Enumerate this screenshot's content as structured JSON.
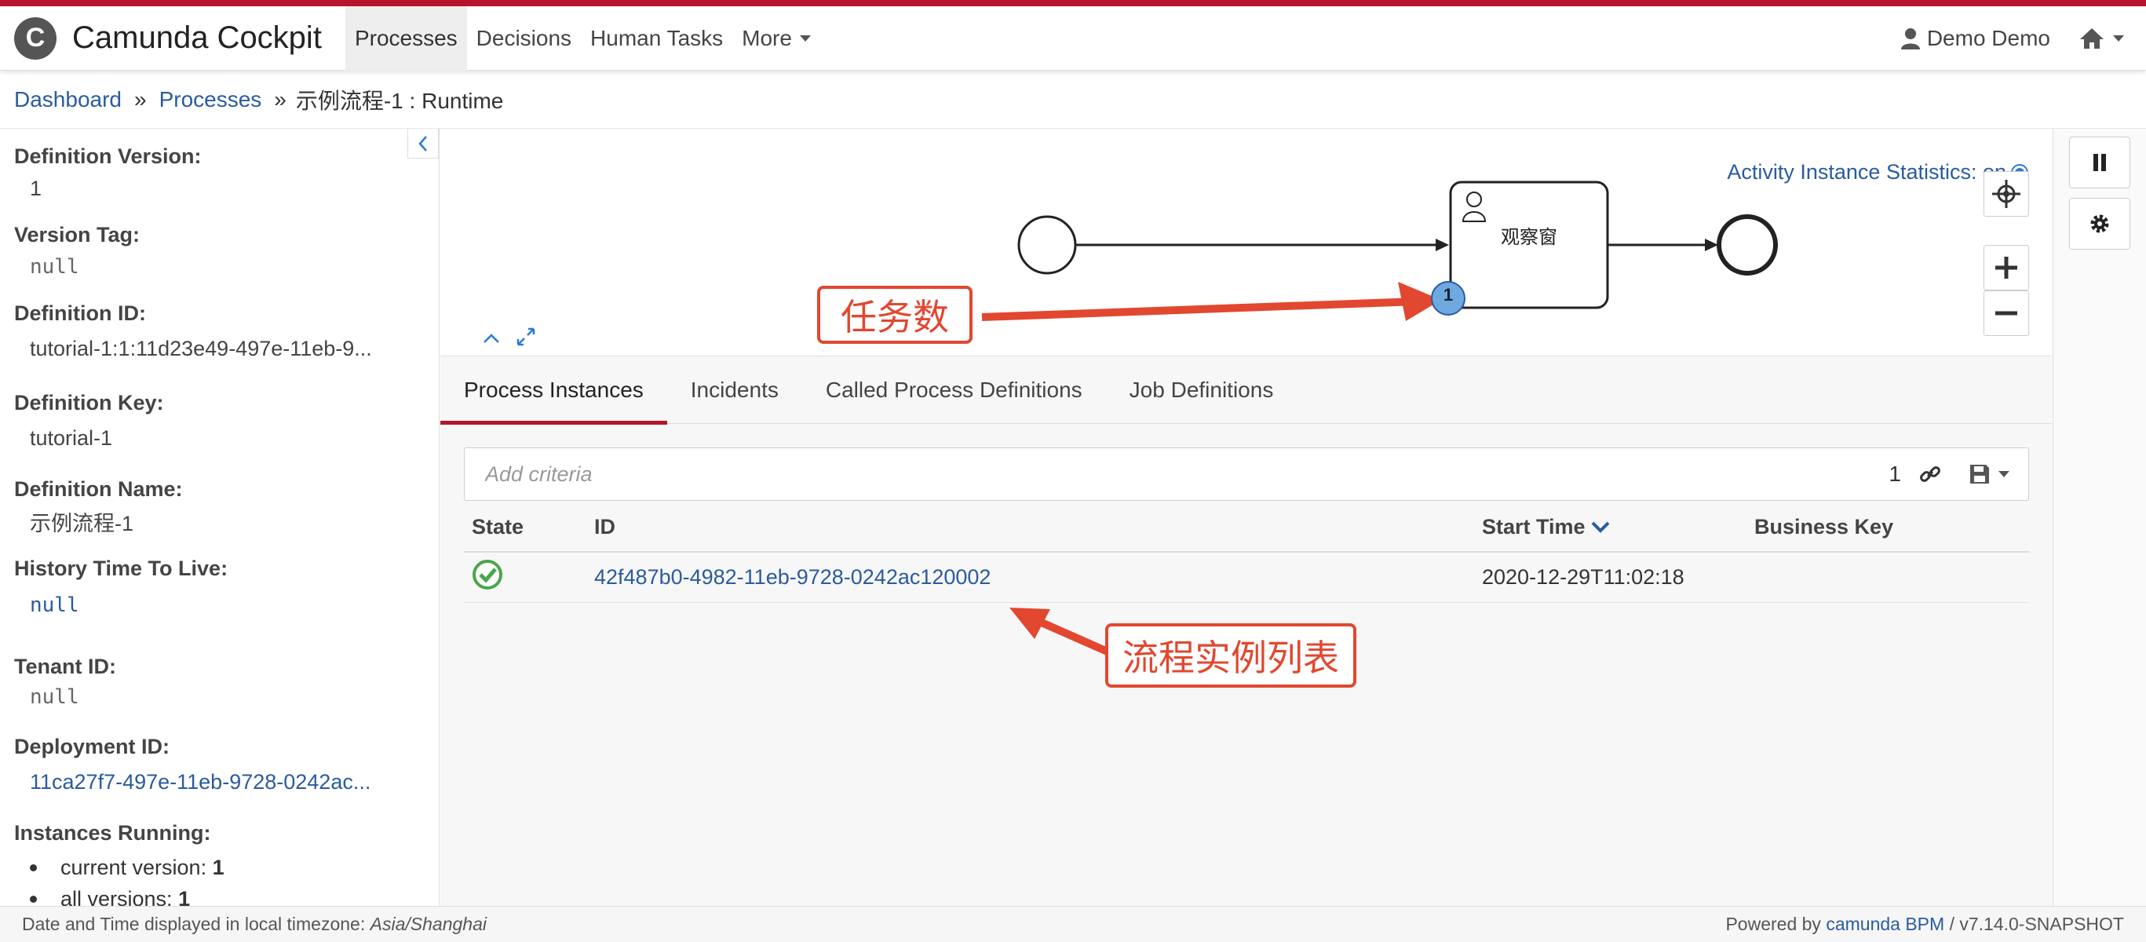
{
  "app": {
    "brand_name": "Camunda Cockpit",
    "logo_glyph": "C",
    "accent_color": "#b5152b"
  },
  "nav": {
    "items": [
      {
        "label": "Processes",
        "active": true
      },
      {
        "label": "Decisions",
        "active": false
      },
      {
        "label": "Human Tasks",
        "active": false
      },
      {
        "label": "More",
        "active": false,
        "dropdown": true
      }
    ],
    "user_label": "Demo Demo",
    "user_icon": "user-icon",
    "home_icon": "home-icon"
  },
  "breadcrumb": {
    "dashboard": "Dashboard",
    "processes": "Processes",
    "separator": "»",
    "current": "示例流程-1 : Runtime"
  },
  "sidebar": {
    "props": [
      {
        "label": "Definition Version:",
        "value": "1",
        "style": "plain"
      },
      {
        "label": "Version Tag:",
        "value": "null",
        "style": "mono"
      },
      {
        "label": "Definition ID:",
        "value": "tutorial-1:1:11d23e49-497e-11eb-9...",
        "style": "plain"
      },
      {
        "label": "Definition Key:",
        "value": "tutorial-1",
        "style": "plain"
      },
      {
        "label": "Definition Name:",
        "value": "示例流程-1",
        "style": "plain"
      },
      {
        "label": "History Time To Live:",
        "value": "null",
        "style": "mono-link"
      },
      {
        "label": "Tenant ID:",
        "value": "null",
        "style": "mono"
      },
      {
        "label": "Deployment ID:",
        "value": "11ca27f7-497e-11eb-9728-0242ac...",
        "style": "link"
      }
    ],
    "instances_running_label": "Instances Running:",
    "current_version_label": "current version:",
    "current_version_value": "1",
    "all_versions_label": "all versions:",
    "all_versions_value": "1"
  },
  "diagram": {
    "stats_label": "Activity Instance Statistics: on",
    "task_name": "观察窗",
    "task_badge": "1"
  },
  "tabs": [
    {
      "label": "Process Instances",
      "active": true
    },
    {
      "label": "Incidents",
      "active": false
    },
    {
      "label": "Called Process Definitions",
      "active": false
    },
    {
      "label": "Job Definitions",
      "active": false
    }
  ],
  "search": {
    "placeholder": "Add criteria",
    "count": "1"
  },
  "table": {
    "headers": {
      "state": "State",
      "id": "ID",
      "start_time": "Start Time",
      "business_key": "Business Key"
    },
    "rows": [
      {
        "state_icon": "check-circle-icon",
        "id": "42f487b0-4982-11eb-9728-0242ac120002",
        "start_time": "2020-12-29T11:02:18",
        "business_key": ""
      }
    ]
  },
  "annotations": {
    "task_count": "任务数",
    "instance_list": "流程实例列表",
    "color": "#e2472f"
  },
  "footer": {
    "timezone_prefix": "Date and Time displayed in local timezone:",
    "timezone": "Asia/Shanghai",
    "powered_by": "Powered by",
    "product": "camunda BPM",
    "version": "/ v7.14.0-SNAPSHOT"
  }
}
